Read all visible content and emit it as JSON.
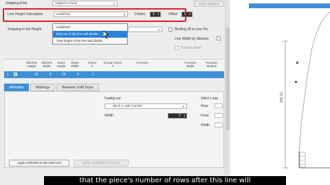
{
  "top": {
    "stepping_kind_label": "Stepping Kind",
    "stepping_kind_value": "Angled to Inside",
    "apply_stepping_button": "Apply Stepping",
    "line_height_label": "Line Height Calculation",
    "line_height_value": "undefined",
    "divider_label": "Divider",
    "divider_value": "2",
    "offset_label": "Offset",
    "offset_value": "0",
    "dropdown_options": [
      "undefined",
      "End row of the line with divider",
      "Total height of the line with divider"
    ],
    "stepping_in_height_label": "Stepping in the Height",
    "binding_off_label": "Binding off at Line Fin",
    "line_width_label": "Line Width by Stitches",
    "pinned_label": "Pinned Value"
  },
  "table": {
    "headers": [
      {
        "line1": "Stitches",
        "line2": "Height"
      },
      {
        "line1": "Stitches",
        "line2": "Width"
      },
      {
        "line1": "Steps",
        "line2": "Height"
      },
      {
        "line1": "Steps",
        "line2": "Width"
      },
      {
        "line1": "Factor",
        "line2": "#"
      },
      {
        "line1": "Group Factor",
        "line2": "#"
      },
      {
        "line1": "Function",
        "line2": ""
      },
      {
        "line1": "Function",
        "line2": "Width"
      },
      {
        "line1": "Function",
        "line2": "Module"
      }
    ],
    "row": {
      "index": "1",
      "c1": "15",
      "c2": "0",
      "c3": "15",
      "c4": "0",
      "c5": "1"
    }
  },
  "tabs": [
    "Attributes",
    "Markings",
    "Behavior of All Sizes"
  ],
  "attributes": {
    "fading_out_label": "Fading out",
    "fading_out_value": "Stitch o. with Transfer",
    "width_label": "Width",
    "width_value": "2",
    "stitch_loop_label": "Stitch Loop",
    "rear_label": "Rear",
    "front_label": "Front",
    "width2_label": "Width"
  },
  "buttons": {
    "apply_mirrored": "Apply Attributes to Mirrored Line",
    "apply_all": "Apply Attributes to All Sizes"
  },
  "diagram": {
    "dimension_label": "145.12"
  },
  "caption": "that the piece's number of rows after this line will"
}
